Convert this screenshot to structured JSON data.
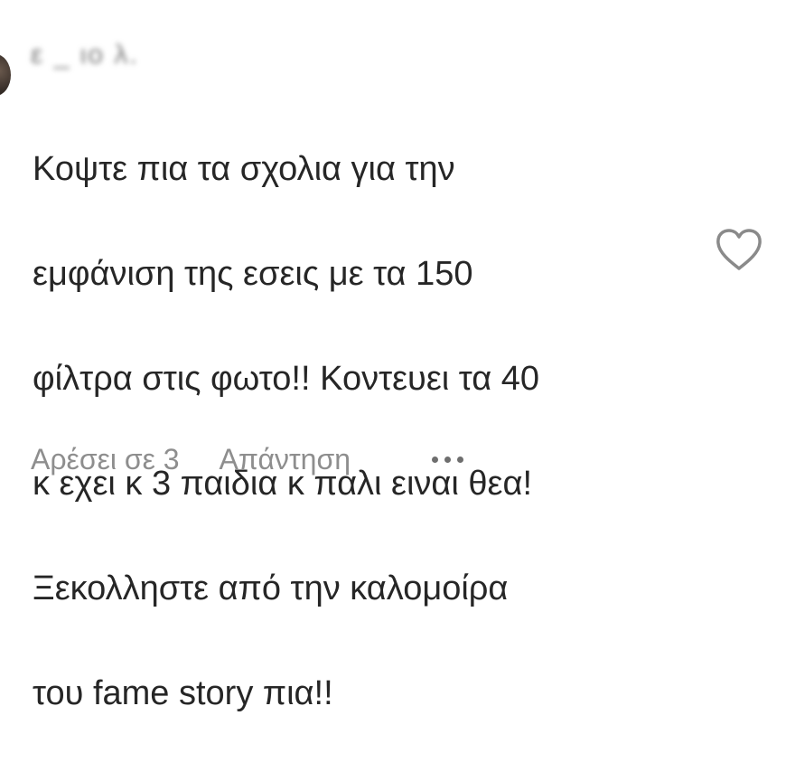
{
  "comment": {
    "username": "ε      _      ιο λ.",
    "text_lines": [
      "Κοψτε πια τα σχολια για την",
      "εμφάνιση της εσεις με τα 150",
      "φίλτρα στις φωτο!! Κοντευει τα 40",
      "κ εχει κ 3 παιδια κ παλι ειναι θεα!",
      "Ξεκολληστε από την καλομοίρα",
      "του fame story πια!!"
    ],
    "likes_label": "Αρέσει σε 3",
    "reply_label": "Απάντηση",
    "like_icon": "heart-outline-icon",
    "more_icon": "more-options-icon"
  }
}
